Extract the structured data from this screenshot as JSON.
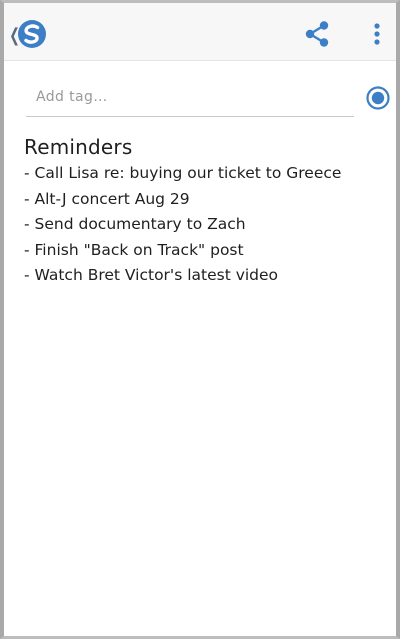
{
  "toolbar": {
    "back_icon": "chevron-left-icon",
    "logo_icon": "simplenote-logo-icon",
    "share_icon": "share-icon",
    "more_icon": "more-vert-icon",
    "accent_color": "#3d7fc6"
  },
  "tag_input": {
    "placeholder": "Add tag…",
    "value": ""
  },
  "sync_icon": "sync-status-dot-icon",
  "note": {
    "title": "Reminders",
    "lines": [
      "- Call Lisa re: buying our ticket to Greece",
      "- Alt-J concert Aug 29",
      "- Send documentary to Zach",
      "- Finish \"Back on Track\" post",
      "- Watch Bret Victor's latest video"
    ]
  }
}
